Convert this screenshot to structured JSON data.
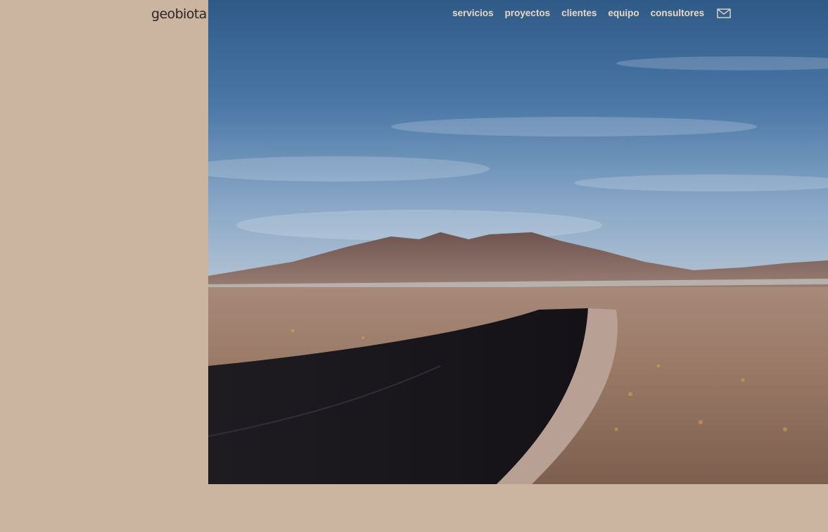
{
  "brand": {
    "name": "geobiota"
  },
  "nav": {
    "items": [
      {
        "label": "servicios"
      },
      {
        "label": "proyectos"
      },
      {
        "label": "clientes"
      },
      {
        "label": "equipo"
      },
      {
        "label": "consultores"
      }
    ],
    "contact_icon": "mail-icon"
  },
  "hero": {
    "image": "desert-road-landscape"
  },
  "colors": {
    "page_background": "#cbb4a0",
    "nav_text": "#e9d8c4",
    "logo_text": "#2b2623"
  }
}
